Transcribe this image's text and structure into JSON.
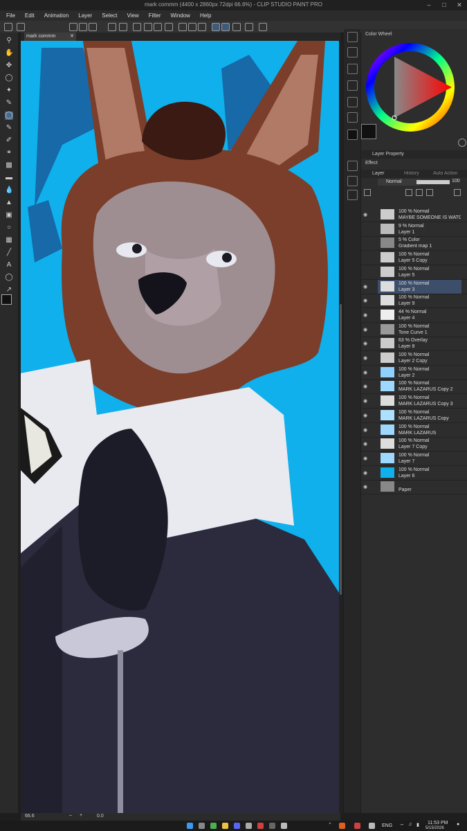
{
  "window": {
    "title": "mark commm (4400 x 2860px 72dpi 66.6%) - CLIP STUDIO PAINT PRO"
  },
  "menu": [
    "File",
    "Edit",
    "Animation",
    "Layer",
    "Select",
    "View",
    "Filter",
    "Window",
    "Help"
  ],
  "canvas_tab": {
    "label": "mark commm"
  },
  "status": {
    "zoom": "66.6",
    "angle": "0.0"
  },
  "panels": {
    "color_wheel": "Color Wheel",
    "layer_property": "Layer Property",
    "effect": "Effect",
    "tabs": [
      "Layer",
      "History",
      "Auto Action"
    ],
    "blend_mode": "Normal",
    "opacity": "100"
  },
  "layers": [
    {
      "mode": "100 % Normal",
      "name": "MAYBE SOMEONE IS WATCHING OU",
      "selected": false,
      "visible": true
    },
    {
      "mode": "9 % Normal",
      "name": "Layer 1",
      "selected": false,
      "visible": false
    },
    {
      "mode": "5 % Color",
      "name": "Gradient map 1",
      "selected": false,
      "visible": false
    },
    {
      "mode": "100 % Normal",
      "name": "Layer 5 Copy",
      "selected": false,
      "visible": false
    },
    {
      "mode": "100 % Normal",
      "name": "Layer 5",
      "selected": false,
      "visible": false
    },
    {
      "mode": "100 % Normal",
      "name": "Layer 3",
      "selected": true,
      "visible": true
    },
    {
      "mode": "100 % Normal",
      "name": "Layer 9",
      "selected": false,
      "visible": true
    },
    {
      "mode": "44 % Normal",
      "name": "Layer 4",
      "selected": false,
      "visible": true
    },
    {
      "mode": "100 % Normal",
      "name": "Tone Curve 1",
      "selected": false,
      "visible": true
    },
    {
      "mode": "63 % Overlay",
      "name": "Layer 8",
      "selected": false,
      "visible": true
    },
    {
      "mode": "100 % Normal",
      "name": "Layer 2 Copy",
      "selected": false,
      "visible": true
    },
    {
      "mode": "100 % Normal",
      "name": "Layer 2",
      "selected": false,
      "visible": true
    },
    {
      "mode": "100 % Normal",
      "name": "MARK LAZARUS Copy 2",
      "selected": false,
      "visible": true
    },
    {
      "mode": "100 % Normal",
      "name": "MARK LAZARUS Copy 3",
      "selected": false,
      "visible": true
    },
    {
      "mode": "100 % Normal",
      "name": "MARK LAZARUS Copy",
      "selected": false,
      "visible": true
    },
    {
      "mode": "100 % Normal",
      "name": "MARK LAZARUS",
      "selected": false,
      "visible": true
    },
    {
      "mode": "100 % Normal",
      "name": "Layer 7 Copy",
      "selected": false,
      "visible": true
    },
    {
      "mode": "100 % Normal",
      "name": "Layer 7",
      "selected": false,
      "visible": true
    },
    {
      "mode": "100 % Normal",
      "name": "Layer 6",
      "selected": false,
      "visible": true
    },
    {
      "mode": "",
      "name": "Paper",
      "selected": false,
      "visible": true
    }
  ],
  "taskbar": {
    "lang": "ENG",
    "time": "11:53 PM",
    "date": "5/15/2026"
  },
  "colors": {
    "canvas_bg": "#0fb0ec",
    "main_color": "#111111",
    "selected_layer": "#3d4e6a"
  }
}
